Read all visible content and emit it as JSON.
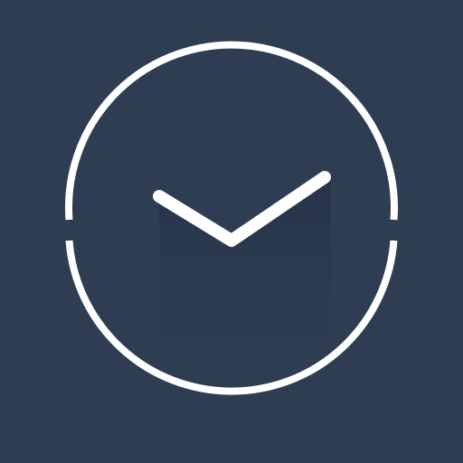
{
  "icon": {
    "name": "clock-icon",
    "colors": {
      "background": "#2e3d52",
      "stroke": "#ffffff",
      "shadow": "#26334a"
    }
  }
}
